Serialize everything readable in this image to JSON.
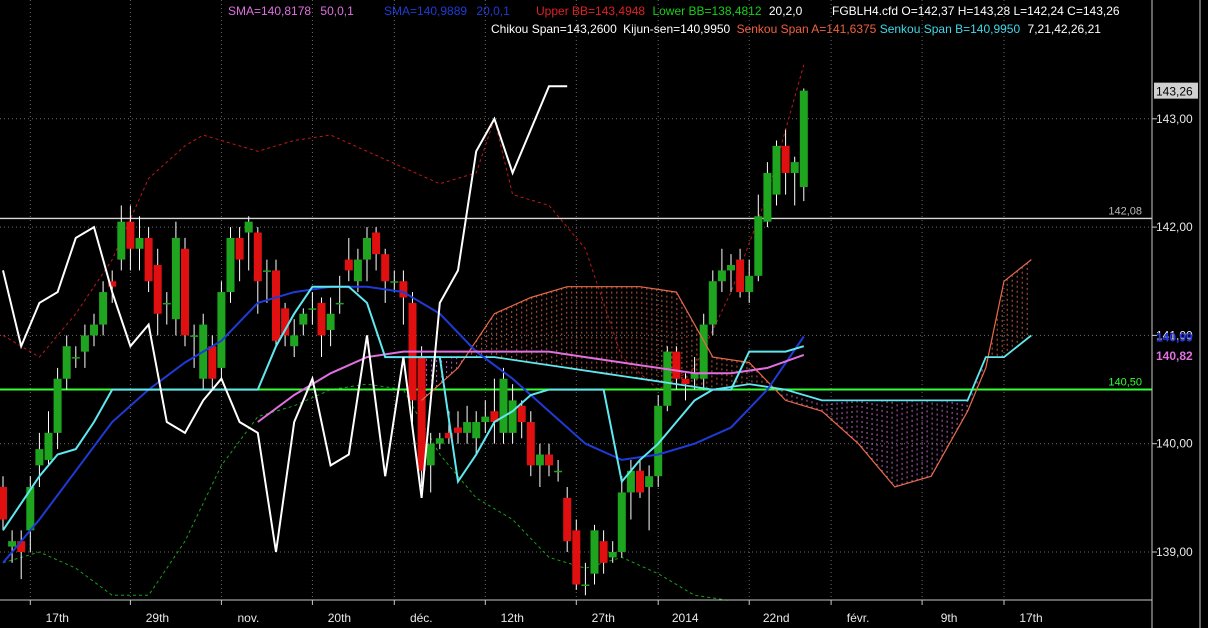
{
  "header": {
    "sma1": {
      "text": "SMA=140,8178",
      "params": "50,0,1",
      "color": "#e070e0"
    },
    "sma2": {
      "text": "SMA=140,9889",
      "params": "20,0,1",
      "color": "#1f3bd6"
    },
    "bb_upper": {
      "text": "Upper BB=143,4948",
      "color": "#e02020"
    },
    "bb_lower": {
      "text": "Lower BB=138,4812",
      "color": "#18d018"
    },
    "bb_params": "20,2,0",
    "ohlc": "FGBLH4.cfd O=142,37 H=143,28 L=142,24 C=143,26",
    "chikou": {
      "text": "Chikou Span=143,2600",
      "color": "#ffffff"
    },
    "kijun": {
      "text": "Kijun-sen=140,9950",
      "color": "#ffffff"
    },
    "senkou_a": {
      "text": "Senkou Span A=141,6375",
      "color": "#f06040"
    },
    "senkou_b": {
      "text": "Senkou Span B=140,9950",
      "color": "#40d8e8"
    },
    "ichimoku_params": "7,21,42,26,21"
  },
  "colors": {
    "background": "#000000",
    "grid": "#6a6a6a",
    "bull": "#1fa41f",
    "bear": "#e01010",
    "wick": "#ffffff",
    "chikou": "#ffffff",
    "kijun": "#5fe8f0",
    "senkou_a": "#e86a4a",
    "senkou_b": "#5fe8f0",
    "cloud_a_fill": "#e86a4a",
    "cloud_b_fill": "#e070e0",
    "sma50": "#e070e0",
    "sma20": "#1f3bd6",
    "bb_upper": "#c01818",
    "bb_lower": "#18a018",
    "hline_white": "#d8d8d8",
    "hline_green": "#33ff33",
    "axis_text": "#e8e8e8"
  },
  "chart_data": {
    "type": "candlestick",
    "symbol": "FGBLH4.cfd",
    "y_axis": {
      "ylim": [
        138.55,
        144.0
      ],
      "tick_values": [
        139.0,
        140.0,
        141.0,
        142.0,
        143.0
      ],
      "tick_labels": [
        "139,00",
        "140,00",
        "141,00",
        "142,00",
        "143,00"
      ]
    },
    "x_axis": {
      "labels": [
        {
          "text": "17th",
          "x": 3
        },
        {
          "text": "29th",
          "x": 14
        },
        {
          "text": "nov.",
          "x": 24
        },
        {
          "text": "20th",
          "x": 34
        },
        {
          "text": "déc.",
          "x": 43
        },
        {
          "text": "12th",
          "x": 53
        },
        {
          "text": "27th",
          "x": 63
        },
        {
          "text": "2014",
          "x": 72
        },
        {
          "text": "22nd",
          "x": 82
        },
        {
          "text": "févr.",
          "x": 91
        },
        {
          "text": "9th",
          "x": 101
        },
        {
          "text": "17th",
          "x": 110
        }
      ]
    },
    "horizontal_lines": [
      {
        "value": 142.08,
        "label": "142,08",
        "color": "#d8d8d8"
      },
      {
        "value": 140.5,
        "label": "140,50",
        "color": "#33ff33"
      }
    ],
    "price_labels": [
      {
        "value": 143.26,
        "text": "143,26",
        "color": "#000000",
        "bg": "#d0d0d0"
      },
      {
        "value": 140.99,
        "text": "140,99",
        "color": "#2a3ae8",
        "bg": "none"
      },
      {
        "value": 140.82,
        "text": "140,82",
        "color": "#e070e0",
        "bg": "none"
      }
    ],
    "candles": [
      [
        0,
        139.6,
        139.3,
        139.7,
        139.2
      ],
      [
        1,
        139.05,
        139.1,
        139.2,
        138.9
      ],
      [
        2,
        139.1,
        139.0,
        139.2,
        138.75
      ],
      [
        3,
        139.2,
        139.6,
        139.7,
        139.0
      ],
      [
        4,
        139.8,
        139.95,
        140.1,
        139.6
      ],
      [
        5,
        139.85,
        140.1,
        140.3,
        139.8
      ],
      [
        6,
        140.1,
        140.6,
        140.7,
        139.95
      ],
      [
        7,
        140.6,
        140.9,
        141.0,
        140.5
      ],
      [
        8,
        140.8,
        140.8,
        140.9,
        140.7
      ],
      [
        9,
        140.85,
        141.0,
        141.1,
        140.7
      ],
      [
        10,
        141.0,
        141.1,
        141.2,
        140.9
      ],
      [
        11,
        141.1,
        141.4,
        141.5,
        141.0
      ],
      [
        12,
        141.5,
        141.45,
        141.6,
        141.3
      ],
      [
        13,
        141.7,
        142.05,
        142.2,
        141.6
      ],
      [
        14,
        142.05,
        141.8,
        142.2,
        141.6
      ],
      [
        15,
        141.8,
        141.9,
        142.1,
        141.6
      ],
      [
        16,
        141.9,
        141.5,
        142.0,
        141.4
      ],
      [
        17,
        141.65,
        141.2,
        141.8,
        141.0
      ],
      [
        18,
        141.3,
        141.3,
        141.4,
        141.1
      ],
      [
        19,
        141.15,
        141.9,
        142.05,
        141.0
      ],
      [
        20,
        141.8,
        141.0,
        141.9,
        140.9
      ],
      [
        21,
        141.0,
        141.0,
        141.1,
        140.7
      ],
      [
        22,
        140.6,
        141.1,
        141.2,
        140.5
      ],
      [
        23,
        140.9,
        140.6,
        141.0,
        140.5
      ],
      [
        24,
        140.7,
        141.4,
        141.5,
        140.6
      ],
      [
        25,
        141.4,
        141.9,
        142.0,
        141.3
      ],
      [
        26,
        141.9,
        141.7,
        142.0,
        141.5
      ],
      [
        27,
        141.95,
        142.05,
        142.1,
        141.6
      ],
      [
        28,
        141.95,
        141.5,
        142.0,
        141.2
      ],
      [
        29,
        141.6,
        141.6,
        141.7,
        141.3
      ],
      [
        30,
        141.6,
        140.95,
        141.7,
        140.9
      ],
      [
        31,
        141.25,
        141.0,
        141.3,
        140.9
      ],
      [
        32,
        140.9,
        141.0,
        141.15,
        140.8
      ],
      [
        33,
        141.1,
        141.2,
        141.25,
        141.0
      ],
      [
        34,
        141.25,
        141.25,
        141.4,
        141.1
      ],
      [
        35,
        141.3,
        141.0,
        141.35,
        140.8
      ],
      [
        36,
        141.05,
        141.2,
        141.35,
        140.9
      ],
      [
        37,
        141.3,
        141.3,
        141.55,
        141.2
      ],
      [
        38,
        141.7,
        141.6,
        141.9,
        141.5
      ],
      [
        39,
        141.5,
        141.7,
        141.8,
        141.4
      ],
      [
        40,
        141.7,
        141.9,
        142.0,
        141.5
      ],
      [
        41,
        141.95,
        141.75,
        142.0,
        141.6
      ],
      [
        42,
        141.75,
        141.5,
        141.8,
        141.3
      ],
      [
        43,
        141.5,
        141.5,
        141.6,
        141.4
      ],
      [
        44,
        141.5,
        141.35,
        141.6,
        141.1
      ],
      [
        45,
        141.3,
        140.4,
        141.4,
        140.2
      ],
      [
        46,
        140.8,
        139.75,
        140.9,
        139.6
      ],
      [
        47,
        139.8,
        140.0,
        140.1,
        139.55
      ],
      [
        48,
        140.0,
        140.05,
        140.1,
        139.95
      ],
      [
        49,
        140.1,
        140.05,
        140.3,
        140.0
      ],
      [
        50,
        140.15,
        140.1,
        140.3,
        140.0
      ],
      [
        51,
        140.1,
        140.2,
        140.35,
        140.0
      ],
      [
        52,
        140.05,
        140.2,
        140.3,
        139.9
      ],
      [
        53,
        140.2,
        140.25,
        140.4,
        140.1
      ],
      [
        54,
        140.3,
        140.2,
        140.6,
        140.0
      ],
      [
        55,
        140.1,
        140.6,
        140.7,
        140.0
      ],
      [
        56,
        140.1,
        140.4,
        140.55,
        140.0
      ],
      [
        57,
        140.35,
        140.2,
        140.4,
        140.05
      ],
      [
        58,
        140.2,
        139.8,
        140.3,
        139.7
      ],
      [
        59,
        139.8,
        139.9,
        140.0,
        139.6
      ],
      [
        60,
        139.9,
        139.8,
        140.0,
        139.7
      ],
      [
        61,
        139.75,
        139.75,
        139.85,
        139.65
      ],
      [
        62,
        139.5,
        139.1,
        139.6,
        139.0
      ],
      [
        63,
        139.2,
        138.7,
        139.3,
        138.65
      ],
      [
        64,
        138.7,
        138.7,
        138.9,
        138.6
      ],
      [
        65,
        138.8,
        139.2,
        139.25,
        138.7
      ],
      [
        66,
        139.1,
        138.9,
        139.2,
        138.8
      ],
      [
        67,
        138.95,
        139.0,
        139.1,
        138.9
      ],
      [
        68,
        139.0,
        139.55,
        139.7,
        138.95
      ],
      [
        69,
        139.55,
        139.75,
        139.85,
        139.3
      ],
      [
        70,
        139.75,
        139.55,
        139.85,
        139.5
      ],
      [
        71,
        139.6,
        139.7,
        139.8,
        139.2
      ],
      [
        72,
        139.7,
        140.35,
        140.45,
        139.6
      ],
      [
        73,
        140.35,
        140.85,
        140.9,
        140.3
      ],
      [
        74,
        140.85,
        140.6,
        140.9,
        140.5
      ],
      [
        75,
        140.6,
        140.55,
        140.65,
        140.4
      ],
      [
        76,
        140.6,
        140.65,
        140.8,
        140.5
      ],
      [
        77,
        140.6,
        141.1,
        141.2,
        140.5
      ],
      [
        78,
        141.1,
        141.5,
        141.6,
        141.0
      ],
      [
        79,
        141.5,
        141.6,
        141.8,
        141.4
      ],
      [
        80,
        141.6,
        141.65,
        141.75,
        141.4
      ],
      [
        81,
        141.7,
        141.4,
        141.8,
        141.35
      ],
      [
        82,
        141.4,
        141.55,
        141.7,
        141.3
      ],
      [
        83,
        141.55,
        142.1,
        142.3,
        141.5
      ],
      [
        84,
        142.05,
        142.5,
        142.6,
        142.0
      ],
      [
        85,
        142.3,
        142.75,
        142.8,
        142.2
      ],
      [
        86,
        142.75,
        142.5,
        142.9,
        142.3
      ],
      [
        87,
        142.5,
        142.6,
        142.65,
        142.2
      ],
      [
        88,
        142.37,
        143.26,
        143.28,
        142.24
      ]
    ],
    "series": [
      {
        "name": "Chikou Span",
        "color": "#ffffff",
        "x": [
          0,
          2,
          4,
          6,
          8,
          10,
          12,
          14,
          16,
          18,
          20,
          22,
          24,
          26,
          28,
          30,
          32,
          34,
          36,
          38,
          40,
          42,
          44,
          46,
          48,
          50,
          52,
          54,
          56,
          58,
          60,
          62
        ],
        "values": [
          141.6,
          140.9,
          141.3,
          141.4,
          141.9,
          142.0,
          141.4,
          140.9,
          141.1,
          140.2,
          140.1,
          140.4,
          140.6,
          140.2,
          140.1,
          139.0,
          140.2,
          140.6,
          139.8,
          139.9,
          141.0,
          139.7,
          140.8,
          139.5,
          141.3,
          141.6,
          142.7,
          143.0,
          142.5,
          142.9,
          143.3,
          143.3
        ]
      },
      {
        "name": "Kijun-sen",
        "color": "#5fe8f0",
        "x": [
          0,
          2,
          4,
          6,
          8,
          10,
          12,
          14,
          16,
          18,
          20,
          22,
          24,
          26,
          28,
          30,
          32,
          34,
          36,
          38,
          40,
          42,
          44,
          46,
          48,
          50,
          52,
          54,
          56,
          58,
          60,
          62,
          64,
          66,
          68,
          70,
          72,
          74,
          76,
          78,
          80,
          82,
          84,
          86,
          88
        ],
        "values": [
          139.2,
          139.45,
          139.7,
          139.9,
          139.95,
          140.2,
          140.5,
          140.5,
          140.5,
          140.5,
          140.5,
          140.5,
          140.5,
          140.5,
          140.5,
          140.9,
          141.2,
          141.45,
          141.45,
          141.45,
          141.3,
          140.8,
          140.8,
          140.8,
          140.8,
          139.65,
          139.9,
          140.2,
          140.3,
          140.45,
          140.5,
          140.5,
          140.5,
          140.5,
          139.65,
          139.85,
          140.0,
          140.2,
          140.4,
          140.5,
          140.5,
          140.85,
          140.85,
          140.85,
          140.9
        ]
      },
      {
        "name": "Senkou Span A",
        "color": "#e86a4a",
        "x": [
          46,
          50,
          54,
          58,
          62,
          66,
          70,
          74,
          78,
          82,
          86,
          90,
          94,
          98,
          102,
          106,
          108,
          110,
          113
        ],
        "values": [
          140.4,
          140.7,
          141.2,
          141.35,
          141.45,
          141.45,
          141.45,
          141.4,
          140.8,
          140.75,
          140.4,
          140.3,
          140.0,
          139.6,
          139.7,
          140.3,
          140.7,
          141.5,
          141.7
        ]
      },
      {
        "name": "Senkou Span B",
        "color": "#5fe8f0",
        "x": [
          46,
          50,
          54,
          58,
          62,
          66,
          70,
          74,
          78,
          82,
          86,
          90,
          94,
          98,
          102,
          106,
          108,
          110,
          113
        ],
        "values": [
          140.8,
          140.8,
          140.8,
          140.75,
          140.7,
          140.65,
          140.6,
          140.55,
          140.5,
          140.55,
          140.5,
          140.4,
          140.4,
          140.4,
          140.4,
          140.4,
          140.8,
          140.8,
          141.0
        ]
      },
      {
        "name": "SMA 50",
        "color": "#e070e0",
        "x": [
          28,
          32,
          36,
          40,
          44,
          48,
          52,
          56,
          60,
          64,
          68,
          72,
          76,
          80,
          84,
          88
        ],
        "values": [
          140.2,
          140.45,
          140.65,
          140.8,
          140.85,
          140.85,
          140.85,
          140.85,
          140.85,
          140.8,
          140.75,
          140.7,
          140.65,
          140.65,
          140.7,
          140.82
        ]
      },
      {
        "name": "SMA 20",
        "color": "#1f3bd6",
        "x": [
          0,
          4,
          8,
          12,
          16,
          20,
          24,
          28,
          32,
          36,
          40,
          44,
          48,
          52,
          56,
          60,
          64,
          68,
          72,
          76,
          80,
          84,
          88
        ],
        "values": [
          138.9,
          139.3,
          139.75,
          140.2,
          140.5,
          140.75,
          140.95,
          141.3,
          141.4,
          141.45,
          141.45,
          141.4,
          141.2,
          140.85,
          140.6,
          140.3,
          140.0,
          139.85,
          139.9,
          140.0,
          140.15,
          140.5,
          140.99
        ]
      },
      {
        "name": "Upper BB",
        "color": "#c01818",
        "x": [
          0,
          4,
          8,
          12,
          16,
          18,
          20,
          22,
          24,
          28,
          32,
          36,
          40,
          44,
          48,
          52,
          54,
          56,
          60,
          64,
          68,
          72,
          76,
          80,
          84,
          88
        ],
        "values": [
          141.0,
          140.8,
          141.2,
          141.7,
          142.45,
          142.6,
          142.75,
          142.85,
          142.8,
          142.7,
          142.8,
          142.85,
          142.7,
          142.55,
          142.4,
          142.5,
          143.0,
          142.3,
          142.2,
          141.8,
          140.8,
          140.5,
          140.7,
          141.4,
          142.3,
          143.5
        ]
      },
      {
        "name": "Lower BB",
        "color": "#18a018",
        "x": [
          0,
          4,
          8,
          12,
          16,
          20,
          24,
          28,
          32,
          36,
          40,
          44,
          48,
          52,
          56,
          60,
          64,
          68,
          72,
          76,
          80
        ],
        "values": [
          138.9,
          139.0,
          138.85,
          138.6,
          138.6,
          139.1,
          139.8,
          140.25,
          140.35,
          140.5,
          140.55,
          140.5,
          139.9,
          139.5,
          139.3,
          138.95,
          138.85,
          138.95,
          138.8,
          138.6,
          138.55
        ]
      }
    ]
  }
}
